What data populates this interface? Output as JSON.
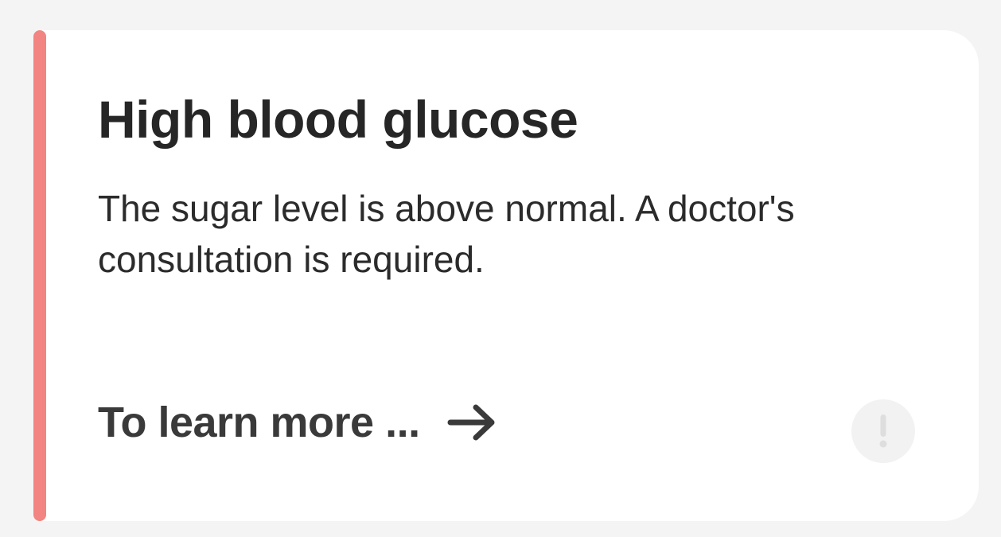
{
  "card": {
    "accent_color": "#f28482",
    "title": "High blood glucose",
    "description": "The sugar level is above normal. A doctor's consultation is required.",
    "learn_more_label": "To learn more ...",
    "arrow_icon": "arrow-right-icon",
    "status_icon": "exclamation-icon"
  }
}
